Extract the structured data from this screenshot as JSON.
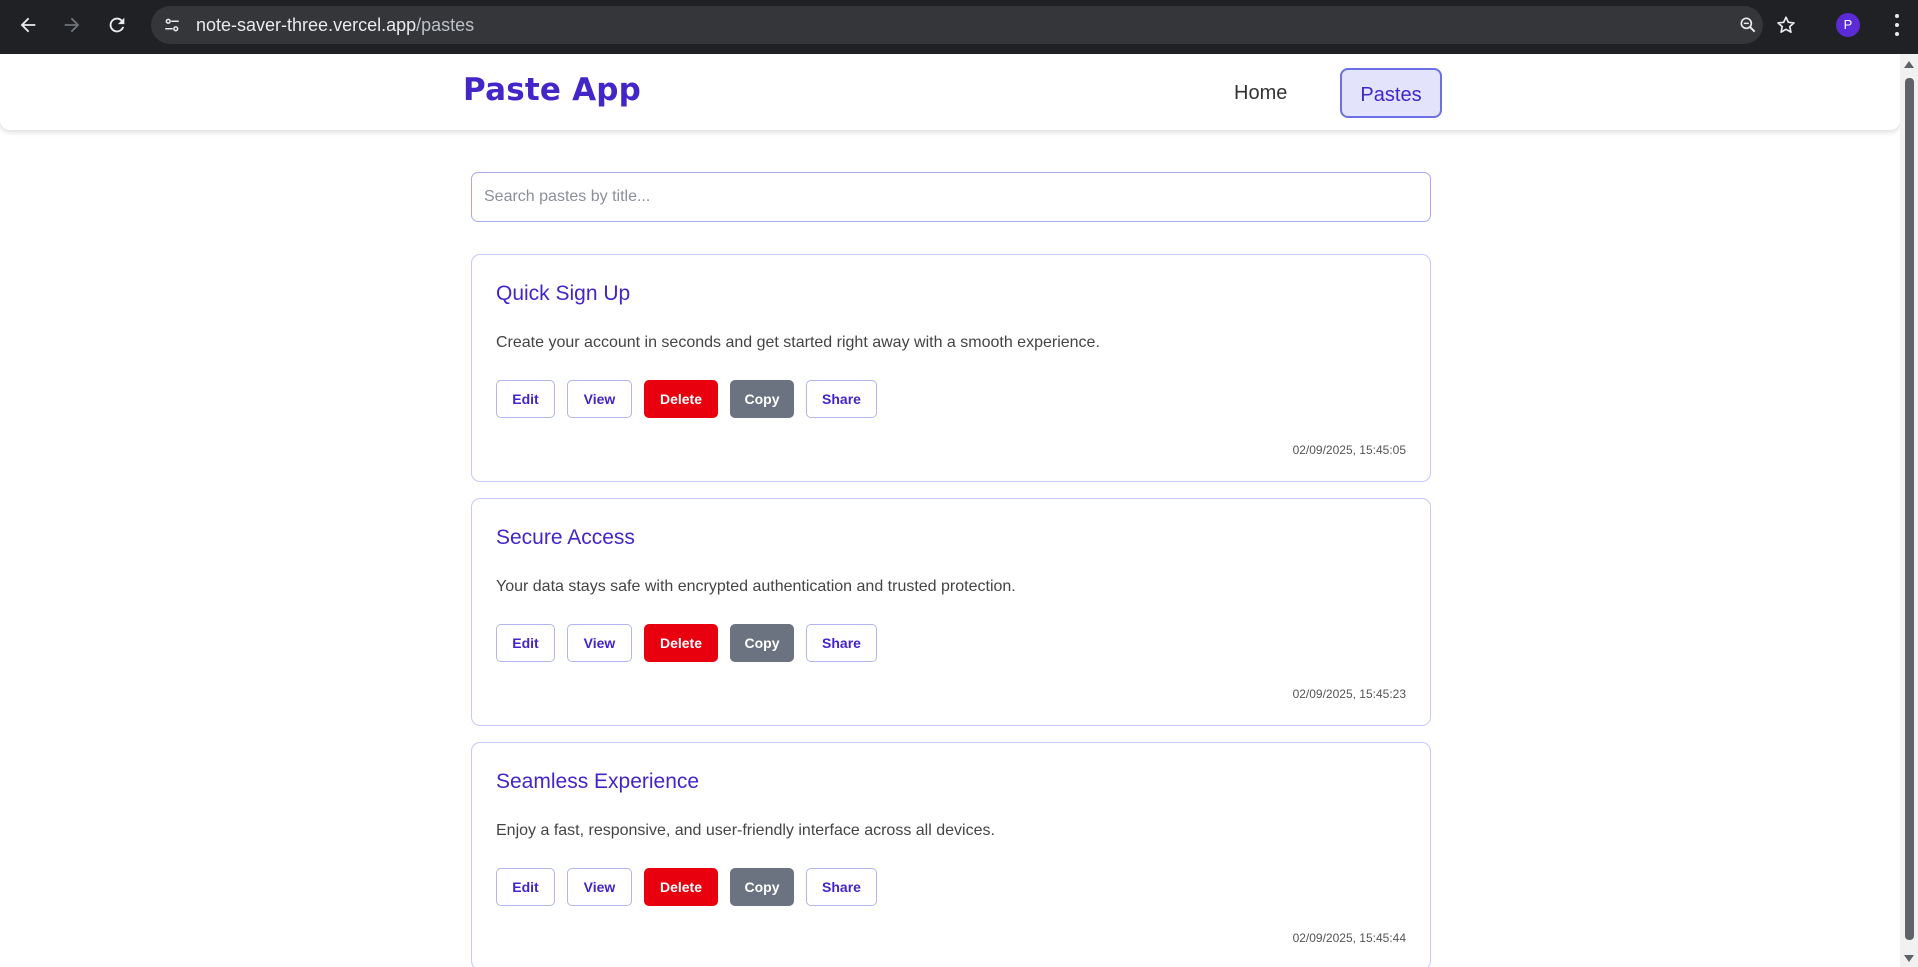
{
  "browser": {
    "url_host": "note-saver-three.vercel.app",
    "url_path": "/pastes",
    "profile_initial": "P",
    "icons": [
      "back-icon",
      "forward-icon",
      "reload-icon",
      "site-info-icon",
      "zoom-icon",
      "bookmark-star-icon",
      "menu-kebab-icon"
    ]
  },
  "header": {
    "brand": "Paste App",
    "nav": [
      {
        "label": "Home",
        "active": false
      },
      {
        "label": "Pastes",
        "active": true
      }
    ]
  },
  "search": {
    "placeholder": "Search pastes by title...",
    "value": ""
  },
  "pastes": [
    {
      "title": "Quick Sign Up",
      "content": "Create your account in seconds and get started right away with a smooth experience.",
      "date": "02/09/2025, 15:45:05"
    },
    {
      "title": "Secure Access",
      "content": "Your data stays safe with encrypted authentication and trusted protection.",
      "date": "02/09/2025, 15:45:23"
    },
    {
      "title": "Seamless Experience",
      "content": "Enjoy a fast, responsive, and user-friendly interface across all devices.",
      "date": "02/09/2025, 15:45:44"
    }
  ],
  "actions": {
    "edit": "Edit",
    "view": "View",
    "delete": "Delete",
    "copy": "Copy",
    "share": "Share"
  },
  "colors": {
    "brand": "#4325c8",
    "delete": "#e8000f",
    "copy": "#6b7280",
    "border": "#c7c8f5",
    "chrome": "#202124"
  }
}
